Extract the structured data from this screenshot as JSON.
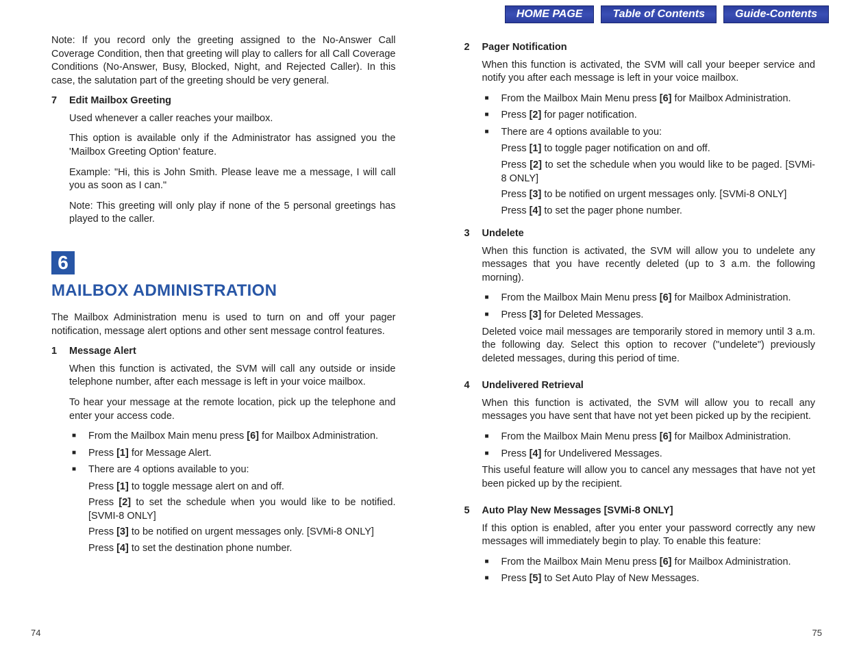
{
  "nav": {
    "home": "HOME PAGE",
    "toc": "Table of Contents",
    "guide": "Guide-Contents"
  },
  "left": {
    "note_top": "Note: If you record only the greeting assigned to the No-Answer Call Coverage Condition, then that greeting will play to callers for all Call Coverage Conditions (No-Answer, Busy, Blocked, Night, and Rejected Caller). In this case, the salutation part of the greeting should be very general.",
    "s7": {
      "num": "7",
      "title": "Edit Mailbox Greeting",
      "p1": "Used whenever a caller reaches your mailbox.",
      "p2": "This option is available only if the Administrator has assigned you the 'Mailbox Greeting Option' feature.",
      "p3": "Example: \"Hi, this is John Smith. Please leave me a message, I will call you as soon as I can.\"",
      "p4": "Note: This greeting will only play if none of the 5 personal greetings has played to the caller."
    },
    "bignum": "6",
    "heading": "MAILBOX ADMINISTRATION",
    "intro": "The Mailbox Administration menu is used to turn on and off your pager notification, message alert options and other sent message control features.",
    "s1": {
      "num": "1",
      "title": "Message Alert",
      "p1": "When this function is activated, the SVM will call any outside or inside telephone number, after each message is left in your voice mailbox.",
      "p2": "To hear your message at the remote location, pick up the telephone and enter your access code.",
      "b1a": "From the Mailbox Main menu press ",
      "b1key": "[6]",
      "b1b": " for Mailbox Administration.",
      "b2a": "Press ",
      "b2key": "[1]",
      "b2b": " for Message Alert.",
      "b3": "There are 4 options available to you:",
      "press1a": "Press ",
      "press1key": "[1]",
      "press1b": " to toggle message alert on and off.",
      "press2a": "Press ",
      "press2key": "[2]",
      "press2b": " to set the schedule when you would like to be notified. [SVMI-8 ONLY]",
      "press3a": "Press ",
      "press3key": "[3]",
      "press3b": " to be notified on urgent messages only. [SVMi-8 ONLY]",
      "press4a": "Press ",
      "press4key": "[4]",
      "press4b": " to set the destination phone number."
    },
    "pagenum": "74"
  },
  "right": {
    "s2": {
      "num": "2",
      "title": "Pager Notification",
      "p1": "When this function is activated, the SVM will call your beeper service and notify you after each message is left in your voice mailbox.",
      "b1a": "From the Mailbox Main Menu press ",
      "b1key": "[6]",
      "b1b": " for Mailbox Administration.",
      "b2a": "Press ",
      "b2key": "[2]",
      "b2b": " for pager notification.",
      "b3": "There are 4 options available to you:",
      "press1a": "Press ",
      "press1key": "[1]",
      "press1b": " to toggle pager notification on and off.",
      "press2a": "Press ",
      "press2key": "[2]",
      "press2b": " to set the schedule when you would like to be paged. [SVMi-8 ONLY]",
      "press3a": "Press ",
      "press3key": "[3]",
      "press3b": " to be notified on urgent messages only. [SVMi-8 ONLY]",
      "press4a": "Press ",
      "press4key": "[4]",
      "press4b": " to set the pager phone number."
    },
    "s3": {
      "num": "3",
      "title": "Undelete",
      "p1": "When this function is activated, the SVM will allow you to undelete any messages that you have recently deleted (up to 3 a.m. the following morning).",
      "b1a": "From the Mailbox Main Menu press ",
      "b1key": "[6]",
      "b1b": " for Mailbox Administration.",
      "b2a": "Press ",
      "b2key": "[3]",
      "b2b": " for Deleted Messages.",
      "p2": "Deleted voice mail messages are temporarily stored in memory until 3 a.m. the following day. Select this option to recover (\"undelete\") previously deleted messages, during this period of time."
    },
    "s4": {
      "num": "4",
      "title": "Undelivered Retrieval",
      "p1": "When this function is activated, the SVM will allow you to recall any messages you have sent that have not yet been picked up by the recipient.",
      "b1a": "From the Mailbox Main Menu press ",
      "b1key": "[6]",
      "b1b": " for Mailbox Administration.",
      "b2a": "Press ",
      "b2key": "[4]",
      "b2b": " for Undelivered Messages.",
      "p2": "This useful feature will allow you to cancel any messages that have not yet been picked up by the recipient."
    },
    "s5": {
      "num": "5",
      "title": "Auto Play New Messages [SVMi-8 ONLY]",
      "p1": "If this option is enabled, after you enter your password correctly any new messages will immediately begin to play. To enable this feature:",
      "b1a": "From the Mailbox Main Menu press ",
      "b1key": "[6]",
      "b1b": " for Mailbox Administration.",
      "b2a": "Press ",
      "b2key": "[5]",
      "b2b": " to Set Auto Play of New Messages."
    },
    "pagenum": "75"
  }
}
